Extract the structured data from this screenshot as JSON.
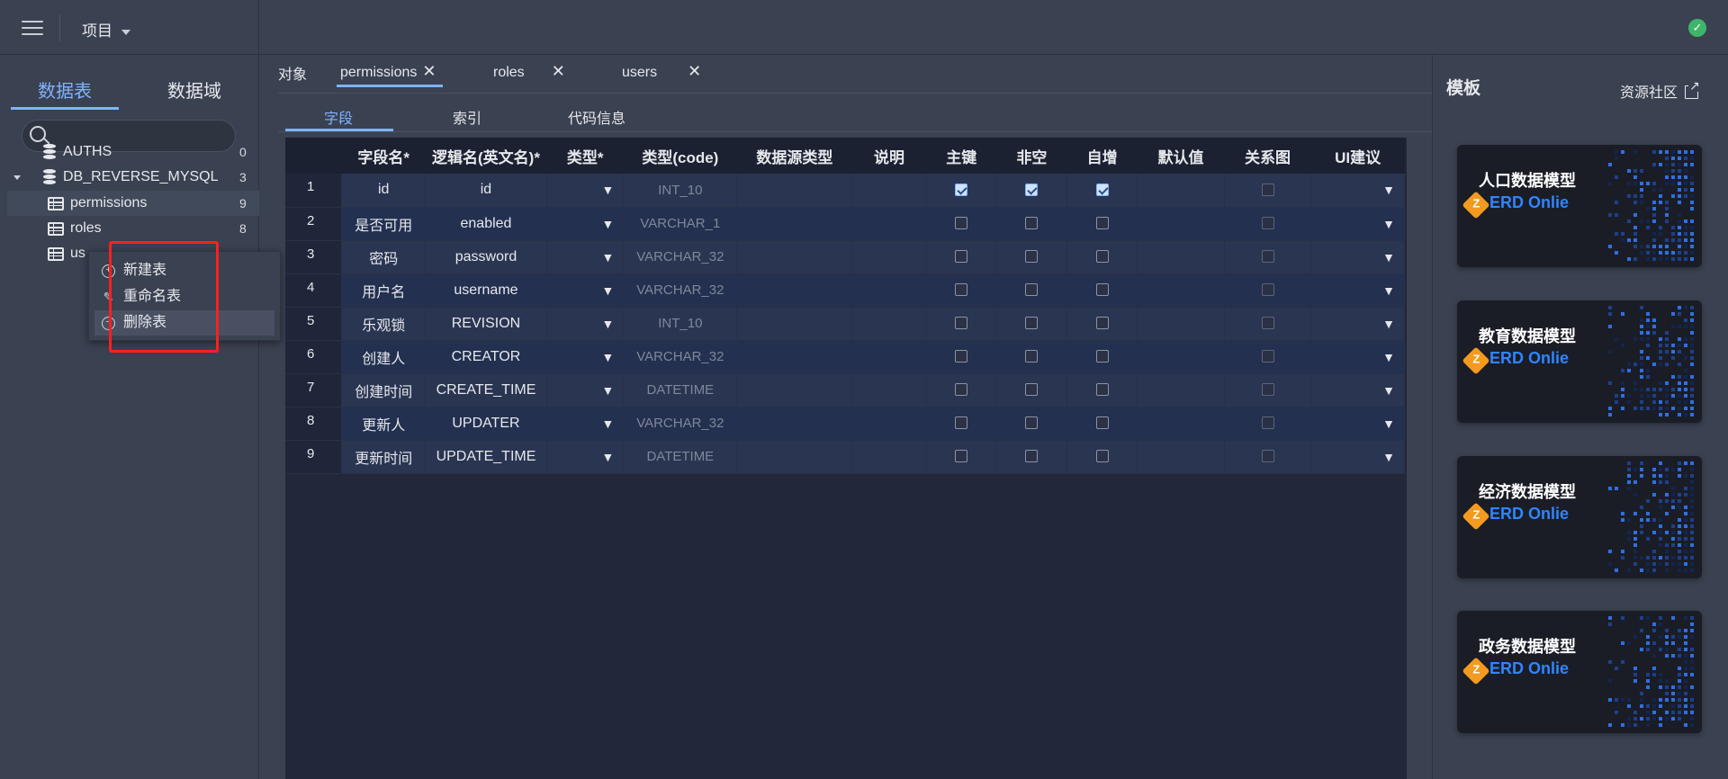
{
  "topbar": {
    "project_label": "项目"
  },
  "sidebar": {
    "tabs": [
      "数据表",
      "数据域"
    ],
    "search_placeholder": "",
    "tree": [
      {
        "name": "AUTHS",
        "count": "0",
        "type": "db"
      },
      {
        "name": "DB_REVERSE_MYSQL",
        "count": "3",
        "type": "db"
      },
      {
        "name": "permissions",
        "count": "9",
        "type": "table"
      },
      {
        "name": "roles",
        "count": "8",
        "type": "table"
      },
      {
        "name": "us",
        "count": "",
        "type": "table"
      }
    ]
  },
  "context_menu": {
    "items": [
      "新建表",
      "重命名表",
      "删除表"
    ]
  },
  "main": {
    "object_label": "对象",
    "object_tabs": [
      "permissions",
      "roles",
      "users"
    ],
    "field_tabs": [
      "字段",
      "索引",
      "代码信息"
    ],
    "columns": [
      "字段名*",
      "逻辑名(英文名)*",
      "类型*",
      "类型(code)",
      "数据源类型",
      "说明",
      "主键",
      "非空",
      "自增",
      "默认值",
      "关系图",
      "UI建议"
    ],
    "rows": [
      {
        "idx": "1",
        "name": "id",
        "logic": "id",
        "code": "INT_10",
        "pk": true,
        "nn": true,
        "ai": true
      },
      {
        "idx": "2",
        "name": "是否可用",
        "logic": "enabled",
        "code": "VARCHAR_1",
        "pk": false,
        "nn": false,
        "ai": false
      },
      {
        "idx": "3",
        "name": "密码",
        "logic": "password",
        "code": "VARCHAR_32",
        "pk": false,
        "nn": false,
        "ai": false
      },
      {
        "idx": "4",
        "name": "用户名",
        "logic": "username",
        "code": "VARCHAR_32",
        "pk": false,
        "nn": false,
        "ai": false
      },
      {
        "idx": "5",
        "name": "乐观锁",
        "logic": "REVISION",
        "code": "INT_10",
        "pk": false,
        "nn": false,
        "ai": false
      },
      {
        "idx": "6",
        "name": "创建人",
        "logic": "CREATOR",
        "code": "VARCHAR_32",
        "pk": false,
        "nn": false,
        "ai": false
      },
      {
        "idx": "7",
        "name": "创建时间",
        "logic": "CREATE_TIME",
        "code": "DATETIME",
        "pk": false,
        "nn": false,
        "ai": false
      },
      {
        "idx": "8",
        "name": "更新人",
        "logic": "UPDATER",
        "code": "VARCHAR_32",
        "pk": false,
        "nn": false,
        "ai": false
      },
      {
        "idx": "9",
        "name": "更新时间",
        "logic": "UPDATE_TIME",
        "code": "DATETIME",
        "pk": false,
        "nn": false,
        "ai": false
      }
    ]
  },
  "right_panel": {
    "title": "模板",
    "link_label": "资源社区",
    "cards": [
      {
        "title": "人口数据模型",
        "brand": "ERD Onlie"
      },
      {
        "title": "教育数据模型",
        "brand": "ERD Onlie"
      },
      {
        "title": "经济数据模型",
        "brand": "ERD Onlie"
      },
      {
        "title": "政务数据模型",
        "brand": "ERD Onlie"
      }
    ]
  },
  "colors": {
    "accent": "#7eb3ff",
    "success": "#3fb56a",
    "highlight_box": "#ff1f1f",
    "brand": "#2f85ff"
  }
}
